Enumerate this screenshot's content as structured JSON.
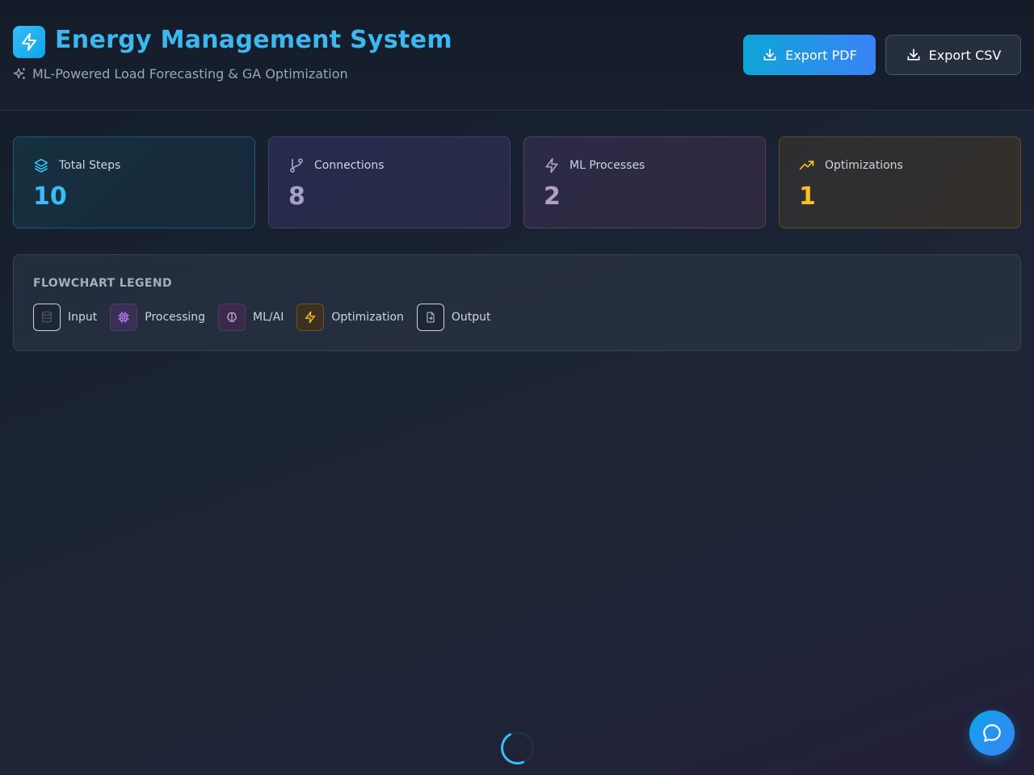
{
  "header": {
    "title": "Energy Management System",
    "subtitle": "ML-Powered Load Forecasting & GA Optimization",
    "brand_icon": "lightning-bolt-icon",
    "accent": "#38bdf8"
  },
  "actions": {
    "export_pdf": "Export PDF",
    "export_csv": "Export CSV"
  },
  "stats": [
    {
      "label": "Total Steps",
      "value": "10",
      "icon": "layers-icon",
      "color": "#38bdf8"
    },
    {
      "label": "Connections",
      "value": "8",
      "icon": "git-branch-icon",
      "color": "#a79fca"
    },
    {
      "label": "ML Processes",
      "value": "2",
      "icon": "lightning-bolt-icon",
      "color": "#b29fc4"
    },
    {
      "label": "Optimizations",
      "value": "1",
      "icon": "trending-up-icon",
      "color": "#fbbf24"
    }
  ],
  "legend": {
    "title": "FLOWCHART LEGEND",
    "items": [
      {
        "label": "Input",
        "icon": "database-icon"
      },
      {
        "label": "Processing",
        "icon": "cpu-icon"
      },
      {
        "label": "ML/AI",
        "icon": "brain-icon"
      },
      {
        "label": "Optimization",
        "icon": "lightning-bolt-icon"
      },
      {
        "label": "Output",
        "icon": "file-output-icon"
      }
    ]
  },
  "status": {
    "loading": true
  },
  "chat": {
    "icon": "chat-bubble-icon"
  }
}
